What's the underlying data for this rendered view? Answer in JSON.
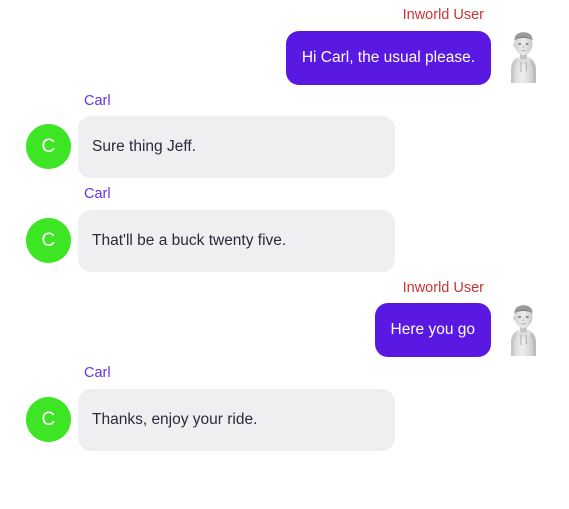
{
  "speakers": {
    "user": {
      "name": "Inworld User",
      "name_color": "#cc3333",
      "bubble_color": "#5a19e2",
      "text_color": "#ffffff",
      "avatar_icon": "user-avatar-3d-portrait"
    },
    "agent": {
      "name": "Carl",
      "name_color": "#6633ee",
      "bubble_color": "#efeff1",
      "text_color": "#2a2a3c",
      "avatar_initial": "C",
      "avatar_color": "#3de524"
    }
  },
  "messages": [
    {
      "speaker": "user",
      "name": "Inworld User",
      "text": "Hi Carl, the usual please."
    },
    {
      "speaker": "agent",
      "name": "Carl",
      "text": "Sure thing Jeff."
    },
    {
      "speaker": "agent",
      "name": "Carl",
      "text": "That'll be a buck twenty five."
    },
    {
      "speaker": "user",
      "name": "Inworld User",
      "text": "Here you go"
    },
    {
      "speaker": "agent",
      "name": "Carl",
      "text": "Thanks, enjoy your ride."
    }
  ]
}
